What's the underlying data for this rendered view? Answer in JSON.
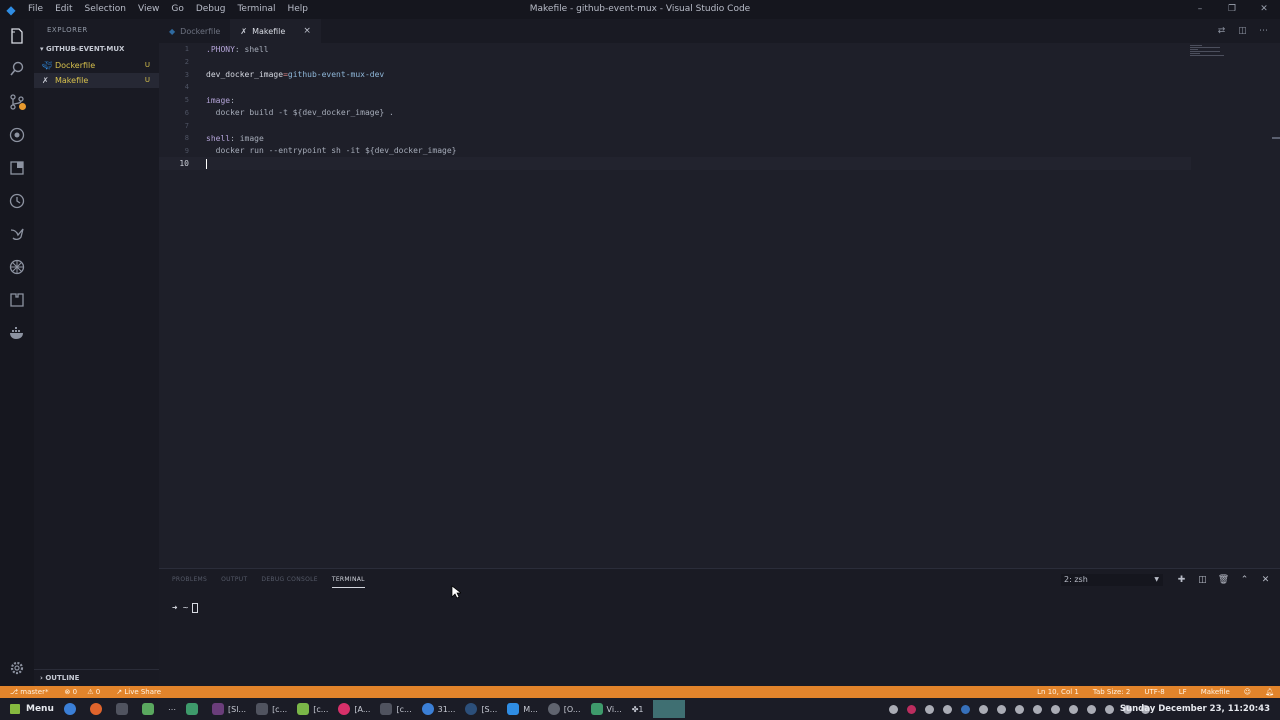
{
  "window": {
    "title": "Makefile - github-event-mux - Visual Studio Code",
    "menu": [
      "File",
      "Edit",
      "Selection",
      "View",
      "Go",
      "Debug",
      "Terminal",
      "Help"
    ]
  },
  "explorer": {
    "header": "EXPLORER",
    "folder": "GITHUB-EVENT-MUX",
    "files": [
      {
        "name": "Dockerfile",
        "badge": "U"
      },
      {
        "name": "Makefile",
        "badge": "U"
      }
    ],
    "outline": "OUTLINE"
  },
  "tabs": [
    {
      "label": "Dockerfile",
      "active": false
    },
    {
      "label": "Makefile",
      "active": true,
      "close": "×"
    }
  ],
  "editor": {
    "line_numbers": [
      "1",
      "2",
      "3",
      "4",
      "5",
      "6",
      "7",
      "8",
      "9",
      "10"
    ],
    "current_line": "10"
  },
  "panel": {
    "tabs": [
      "PROBLEMS",
      "OUTPUT",
      "DEBUG CONSOLE",
      "TERMINAL"
    ],
    "active_tab": "TERMINAL",
    "terminal_select": "2: zsh",
    "prompt": "➜  ~"
  },
  "statusbar": {
    "branch": "master*",
    "errors": "0",
    "warnings": "0",
    "live_share": "Live Share",
    "position": "Ln 10, Col 1",
    "tab_size": "Tab Size: 2",
    "encoding": "UTF-8",
    "eol": "LF",
    "language": "Makefile"
  },
  "taskbar": {
    "menu_label": "Menu",
    "apps": [
      "[Sl...",
      "[c...",
      "[c...",
      "[A...",
      "[c...",
      "31...",
      "[S...",
      "M...",
      "[O...",
      "Vi...",
      "1"
    ],
    "clock": "Sunday December 23, 11:20:43"
  },
  "colors": {
    "accent": "#e2842b",
    "untracked": "#d7c14d",
    "background": "#1e1f29"
  }
}
